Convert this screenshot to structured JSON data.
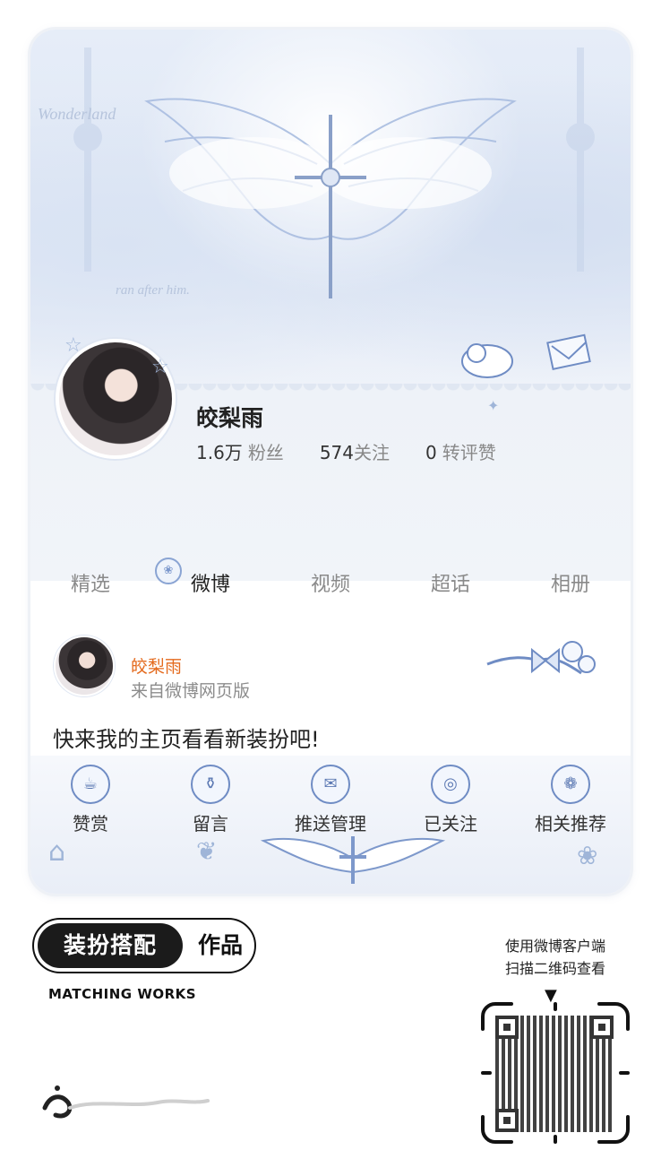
{
  "profile": {
    "username": "皎梨雨",
    "stats": [
      {
        "number": "1.6万",
        "label": "粉丝"
      },
      {
        "number": "574",
        "label": "关注"
      },
      {
        "number": "0",
        "label": "转评赞"
      }
    ]
  },
  "tabs": [
    {
      "label": "精选",
      "active": false
    },
    {
      "label": "微博",
      "active": true
    },
    {
      "label": "视频",
      "active": false
    },
    {
      "label": "超话",
      "active": false
    },
    {
      "label": "相册",
      "active": false
    }
  ],
  "post": {
    "author": "皎梨雨",
    "source": "来自微博网页版",
    "text": "快来我的主页看看新装扮吧!"
  },
  "actions": [
    {
      "label": "赞赏",
      "icon": "teacup-icon"
    },
    {
      "label": "留言",
      "icon": "vase-icon"
    },
    {
      "label": "推送管理",
      "icon": "envelope-icon"
    },
    {
      "label": "已关注",
      "icon": "mirror-icon"
    },
    {
      "label": "相关推荐",
      "icon": "jar-icon"
    }
  ],
  "brand": {
    "dark_text": "装扮搭配",
    "light_text": "作品",
    "subtitle": "MATCHING WORKS"
  },
  "qr": {
    "line1": "使用微博客户端",
    "line2": "扫描二维码查看"
  },
  "colors": {
    "accent_orange": "#e46a1d",
    "theme_blue": "#6f8cc4"
  }
}
